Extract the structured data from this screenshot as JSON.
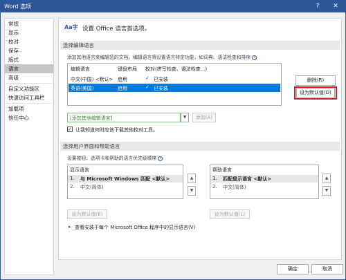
{
  "window": {
    "title": "Word 选项",
    "help_glyph": "?",
    "close_glyph": "✕"
  },
  "sidebar": {
    "items": [
      {
        "label": "常规"
      },
      {
        "label": "显示"
      },
      {
        "label": "校对"
      },
      {
        "label": "保存"
      },
      {
        "label": "版式"
      },
      {
        "label": "语言"
      },
      {
        "label": "高级"
      },
      {
        "label": "自定义功能区"
      },
      {
        "label": "快速访问工具栏"
      },
      {
        "label": "加载项"
      },
      {
        "label": "信任中心"
      }
    ],
    "active_index": 5
  },
  "header": {
    "title": "设置 Office 语言首选项。"
  },
  "editing": {
    "section_title": "选择编辑语言",
    "description": "添加其他语言来编辑您的文档。编辑语言将设置语言特定功能，如词典、语法检查和排序",
    "columns": [
      "编辑语言",
      "键盘布局",
      "校对(拼写检查、语法检查...)"
    ],
    "rows": [
      {
        "language": "中文(中国) <默认>",
        "keyboard": "启用",
        "proofing": "已安装"
      },
      {
        "language": "英语(美国)",
        "keyboard": "启用",
        "proofing": "已安装"
      }
    ],
    "selected_row": 1,
    "delete_button": "删除(R)",
    "default_button": "设为默认值(D)",
    "add_combo": "[添加其他编辑语言]",
    "add_button": "添加(A)",
    "checkbox_label": "让我知道何时应该下载其他校对工具。"
  },
  "display": {
    "section_title": "选择用户界面和帮助语言",
    "description": "设置按钮、选项卡和帮助的语言优先级顺序",
    "display_list": {
      "header": "显示语言",
      "items": [
        {
          "num": "1.",
          "label": "与 Microsoft Windows 匹配 <默认>"
        },
        {
          "num": "2.",
          "label": "中文(简体)"
        }
      ],
      "default_button": "设为默认值(E)"
    },
    "help_list": {
      "header": "帮助语言",
      "items": [
        {
          "num": "1.",
          "label": "匹配显示语言 <默认>"
        },
        {
          "num": "2.",
          "label": "中文(简体)"
        }
      ],
      "default_button": "设为默认值(L)"
    },
    "expander_text": "查看安装于每个 Microsoft Office 程序中的显示语言(V)"
  },
  "footer": {
    "ok_button": "确定",
    "cancel_button": "取消"
  },
  "icons": {
    "language_icon": "Aa字",
    "info_icon": "i",
    "proofing_icon": "✓",
    "combo_arrow": "▼",
    "up_arrow": "▲",
    "down_arrow": "▼",
    "expander_arrow": "▸",
    "checkbox_mark": "✓"
  },
  "colors": {
    "titlebar": "#2b579a",
    "selection": "#0078d7",
    "highlight_box": "#d51c25"
  }
}
